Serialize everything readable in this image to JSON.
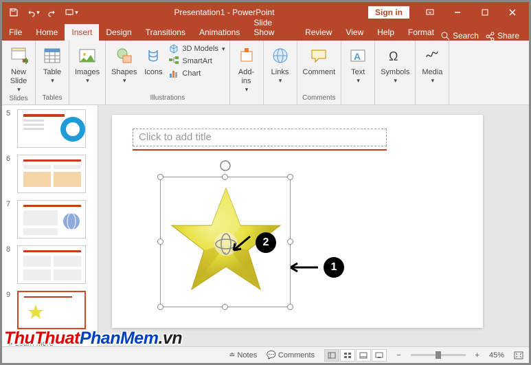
{
  "title": "Presentation1 - PowerPoint",
  "signin": "Sign in",
  "tabs": [
    "File",
    "Home",
    "Insert",
    "Design",
    "Transitions",
    "Animations",
    "Slide Show",
    "Review",
    "View",
    "Help",
    "Format"
  ],
  "active_tab": "Insert",
  "search_label": "Search",
  "share_label": "Share",
  "ribbon": {
    "slides": {
      "new_slide": "New\nSlide",
      "label": "Slides"
    },
    "tables": {
      "table": "Table",
      "label": "Tables"
    },
    "images": {
      "images": "Images"
    },
    "illustrations": {
      "shapes": "Shapes",
      "icons": "Icons",
      "models": "3D Models",
      "smartart": "SmartArt",
      "chart": "Chart",
      "label": "Illustrations"
    },
    "addins": {
      "addins": "Add-\nins"
    },
    "links": {
      "links": "Links"
    },
    "comments": {
      "comment": "Comment",
      "label": "Comments"
    },
    "text": {
      "text": "Text"
    },
    "symbols": {
      "symbols": "Symbols"
    },
    "media": {
      "media": "Media"
    }
  },
  "thumbs": [
    {
      "num": "5"
    },
    {
      "num": "6"
    },
    {
      "num": "7"
    },
    {
      "num": "8"
    },
    {
      "num": "9",
      "sel": true
    }
  ],
  "learn_more": "Learn More",
  "title_placeholder": "Click to add title",
  "callouts": {
    "one": "1",
    "two": "2"
  },
  "status": {
    "notes": "Notes",
    "comments": "Comments",
    "zoom": "45%"
  },
  "watermark": {
    "p1": "ThuThuat",
    "p2": "PhanMem",
    "p3": ".vn"
  }
}
